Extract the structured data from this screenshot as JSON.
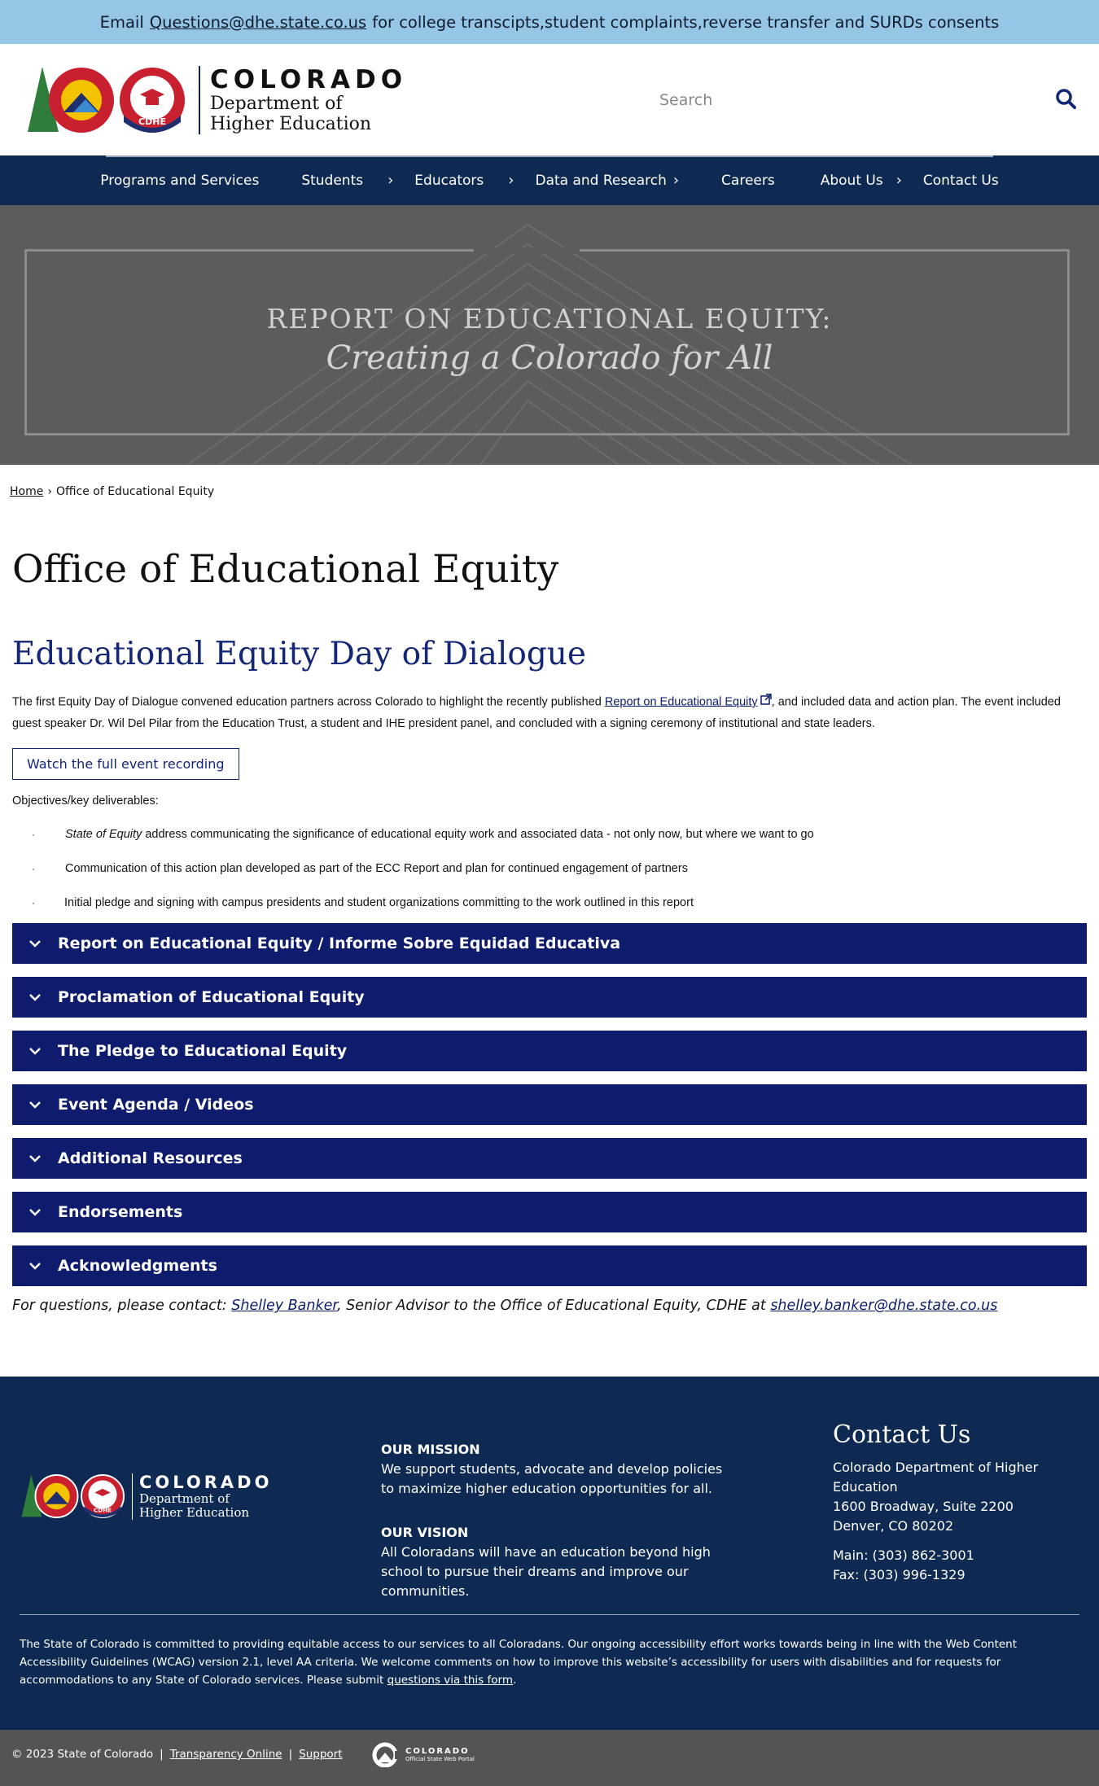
{
  "alert": {
    "prefix": "Email",
    "email": "Questions@dhe.state.co.us",
    "suffix": "for college transcipts,student complaints,reverse transfer and SURDs consents"
  },
  "header": {
    "logo_state": "COLORADO",
    "logo_dept_line1": "Department of",
    "logo_dept_line2": "Higher Education",
    "logo_badge": "CDHE",
    "search_placeholder": "Search"
  },
  "nav": {
    "items": [
      {
        "label": "Programs and Services"
      },
      {
        "label": "Students"
      },
      {
        "label": "Educators"
      },
      {
        "label": "Data and Research"
      },
      {
        "label": "Careers"
      },
      {
        "label": "About Us"
      },
      {
        "label": "Contact Us"
      }
    ]
  },
  "hero": {
    "title": "REPORT ON EDUCATIONAL EQUITY:",
    "subtitle": "Creating a Colorado for All"
  },
  "breadcrumb": {
    "home": "Home",
    "separator": "›",
    "current": "Office of Educational Equity"
  },
  "main": {
    "page_title": "Office of Educational Equity",
    "section_title": "Educational Equity Day of Dialogue",
    "intro_before": "The first Equity Day of Dialogue convened education partners across Colorado to highlight the recently published",
    "intro_link": "Report on Educational Equity",
    "intro_after": ", and included data and action plan. The event included guest speaker Dr. Wil Del Pilar from the Education Trust, a student and IHE president panel, and concluded with a signing ceremony of institutional and state leaders.",
    "recording_button": "Watch the full event recording",
    "objectives_label": "Objectives/key deliverables:",
    "bullet_marker": "·",
    "bullets": [
      {
        "em": "State of Equity",
        "text": " address communicating the significance of educational equity work and associated data - not only now, but where we want to go"
      },
      {
        "em": "",
        "text": "Communication of this action plan developed as part of the ECC Report and plan for continued engagement of partners"
      },
      {
        "em": "",
        "text": "Initial pledge and signing with campus presidents and student organizations committing to the work outlined in this report"
      }
    ],
    "accordion": [
      {
        "label": "Report on Educational Equity / Informe Sobre Equidad Educativa"
      },
      {
        "label": "Proclamation of Educational Equity"
      },
      {
        "label": "The Pledge to Educational Equity"
      },
      {
        "label": "Event Agenda / Videos"
      },
      {
        "label": "Additional Resources"
      },
      {
        "label": "Endorsements"
      },
      {
        "label": "Acknowledgments"
      }
    ],
    "contact_prefix": "For questions, please contact:",
    "contact_name": "Shelley Banker",
    "contact_middle": ", Senior Advisor to the Office of Educational Equity, CDHE at",
    "contact_email": "shelley.banker@dhe.state.co.us"
  },
  "footer": {
    "mission_heading": "OUR MISSION",
    "mission_text": "We support students, advocate and develop policies to maximize higher education opportunities for all.",
    "vision_heading": "OUR VISION",
    "vision_text": "All Coloradans will have an education beyond high school to pursue their dreams and improve our communities.",
    "contact_heading": "Contact Us",
    "address_line1": "Colorado Department of Higher Education",
    "address_line2": "1600 Broadway, Suite 2200",
    "address_line3": "Denver, CO 80202",
    "main_phone": "Main: (303) 862-3001",
    "fax": "Fax: (303) 996-1329",
    "accessibility_text": "The State of Colorado is committed to providing equitable access to our services to all Coloradans. Our ongoing accessibility effort works towards being in line with the Web Content Accessibility Guidelines (WCAG) version 2.1, level AA criteria. We welcome comments on how to improve this website’s accessibility for users with disabilities and for requests for accommodations to any State of Colorado services. Please submit",
    "accessibility_link": "questions via this form",
    "accessibility_end": "."
  },
  "subfooter": {
    "copyright": "© 2023 State of Colorado",
    "separator": "|",
    "transparency": "Transparency Online",
    "support": "Support",
    "portal_name": "COLORADO",
    "portal_sub": "Official State Web Portal"
  },
  "colors": {
    "alert_bg": "#95c6e6",
    "nav_bg": "#0e2a52",
    "accordion_bg": "#0f1c6e",
    "heading_blue": "#132677",
    "footer_bg": "#0e2a52",
    "subfooter_bg": "#545454"
  }
}
